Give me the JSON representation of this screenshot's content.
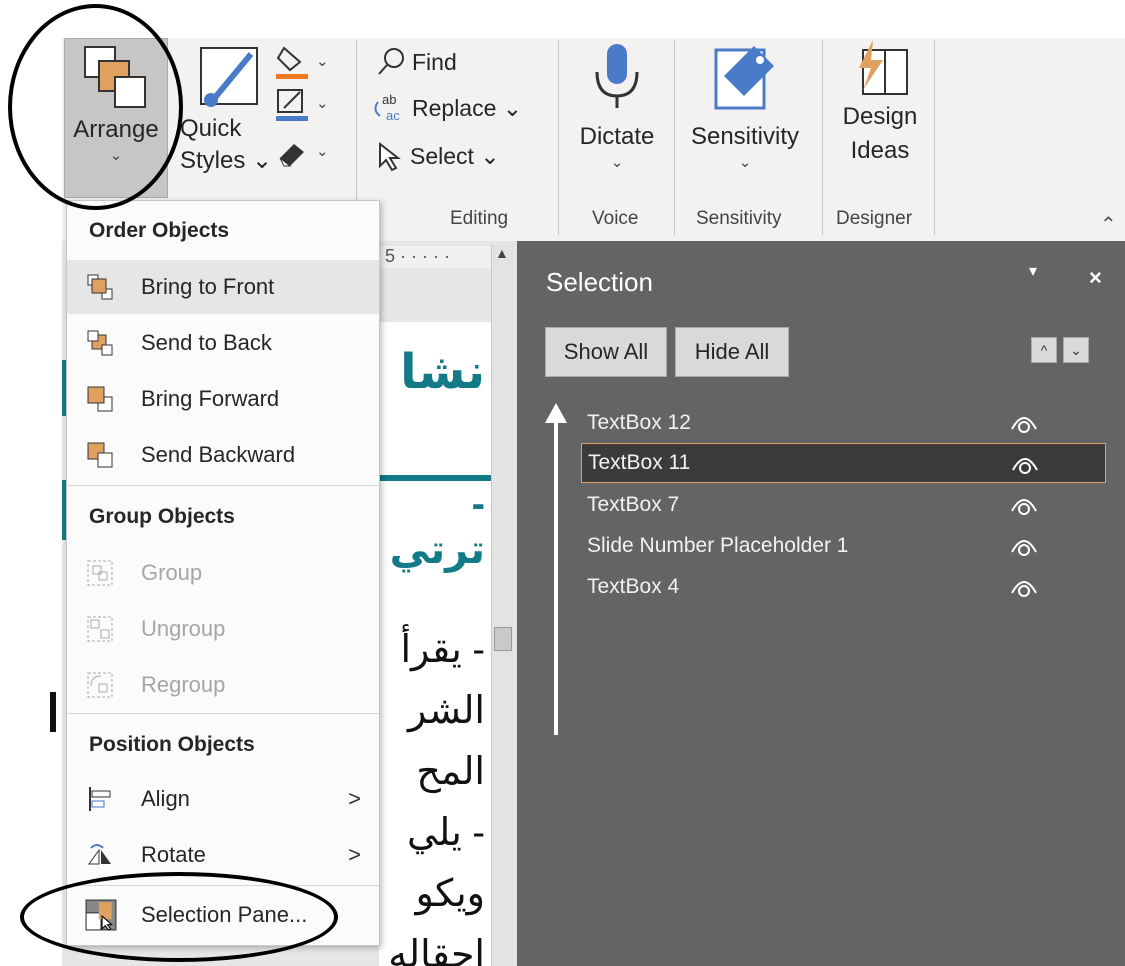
{
  "ribbon": {
    "arrange": {
      "label": "Arrange",
      "chevron": "⌄"
    },
    "quick_styles": {
      "line1": "Quick",
      "line2": "Styles ⌄"
    },
    "editing": {
      "find": "Find",
      "replace": "Replace ⌄",
      "select": "Select ⌄",
      "group_label": "Editing"
    },
    "voice": {
      "dictate": "Dictate",
      "chevron": "⌄",
      "group_label": "Voice"
    },
    "sensitivity": {
      "label": "Sensitivity",
      "chevron": "⌄",
      "group_label": "Sensitivity"
    },
    "designer": {
      "line1": "Design",
      "line2": "Ideas",
      "group_label": "Designer"
    },
    "collapse": "⌃"
  },
  "ruler": {
    "text": "5 · · · · ·"
  },
  "slide": {
    "title_fragment": "نشا",
    "subtitle_fragment": "- ترتي",
    "body_fragment": "- يقرأ\nالشر\nالمح\n- يلي\nويكو\nاحقاله"
  },
  "menu": {
    "order_heading": "Order Objects",
    "bring_to_front": "Bring to Front",
    "send_to_back": "Send to Back",
    "bring_forward": "Bring Forward",
    "send_backward": "Send Backward",
    "group_heading": "Group Objects",
    "group": "Group",
    "ungroup": "Ungroup",
    "regroup": "Regroup",
    "position_heading": "Position Objects",
    "align": "Align",
    "rotate": "Rotate",
    "selection_pane": "Selection Pane...",
    "submenu_arrow": ">"
  },
  "pane": {
    "title": "Selection",
    "dropdown": "▾",
    "close": "×",
    "show_all": "Show All",
    "hide_all": "Hide All",
    "move_up": "^",
    "move_down": "⌄",
    "items": [
      {
        "label": "TextBox 12",
        "selected": false
      },
      {
        "label": "TextBox 11",
        "selected": true
      },
      {
        "label": "TextBox 7",
        "selected": false
      },
      {
        "label": "Slide Number Placeholder 1",
        "selected": false
      },
      {
        "label": "TextBox 4",
        "selected": false
      }
    ]
  },
  "colors": {
    "accent_orange": "#e0a060",
    "slide_teal": "#137a87",
    "pane_bg": "#646464"
  }
}
